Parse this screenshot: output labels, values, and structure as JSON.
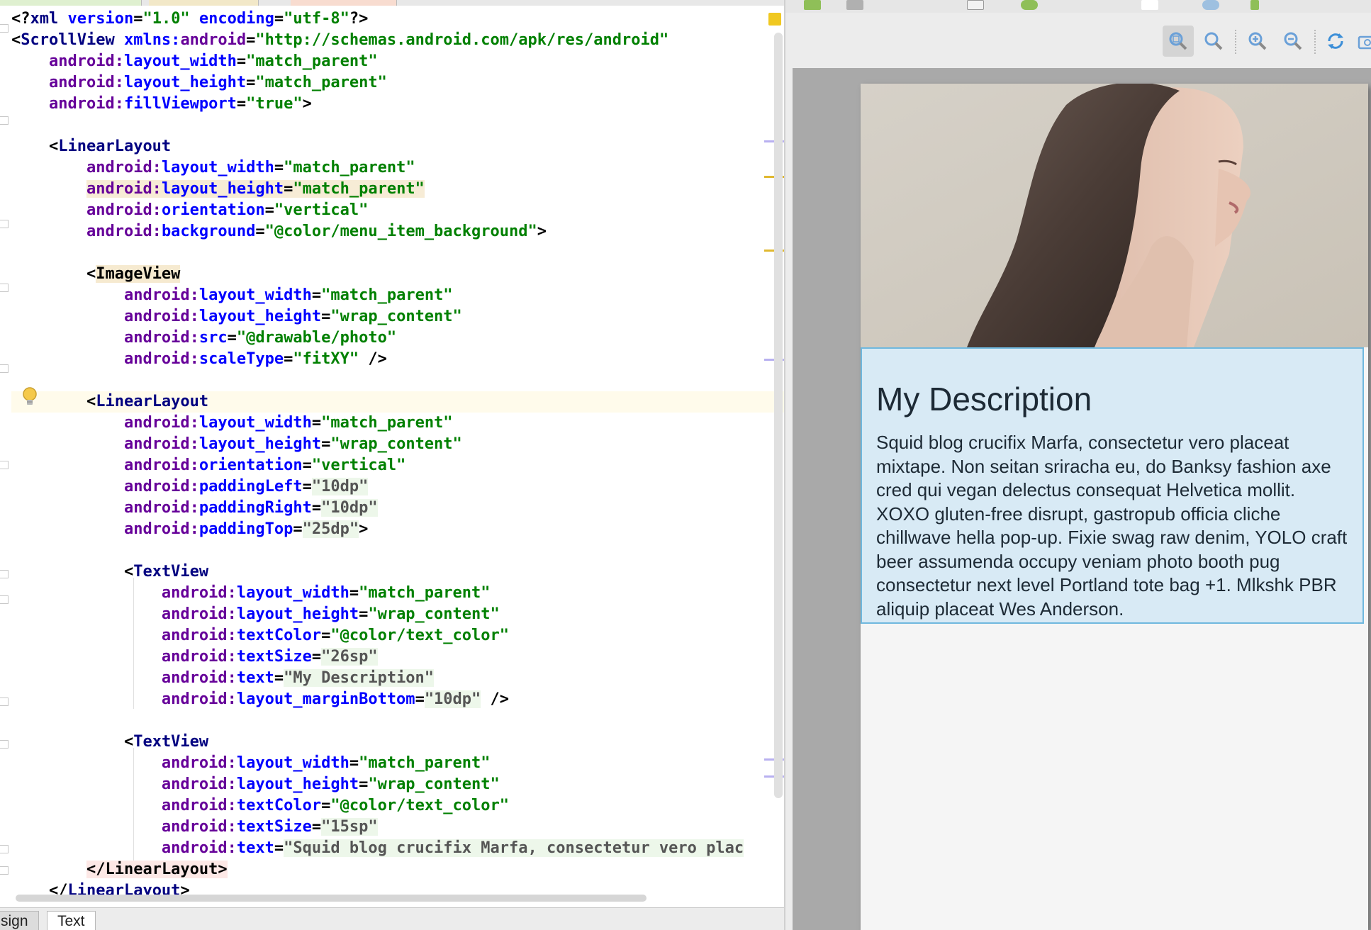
{
  "editor": {
    "lines": [
      {
        "indent": 0,
        "parts": [
          [
            "lt",
            "<?"
          ],
          [
            "tag",
            "xml "
          ],
          [
            "attr",
            "version"
          ],
          [
            "eq",
            "="
          ],
          [
            "val",
            "\"1.0\""
          ],
          [
            "attr",
            " encoding"
          ],
          [
            "eq",
            "="
          ],
          [
            "val",
            "\"utf-8\""
          ],
          [
            "lt",
            "?>"
          ]
        ]
      },
      {
        "indent": 0,
        "parts": [
          [
            "lt",
            "<"
          ],
          [
            "tag",
            "ScrollView "
          ],
          [
            "attr",
            "xmlns:"
          ],
          [
            "ns",
            "android"
          ],
          [
            "eq",
            "="
          ],
          [
            "val",
            "\"http://schemas.android.com/apk/res/android\""
          ]
        ]
      },
      {
        "indent": 4,
        "parts": [
          [
            "ns",
            "android:"
          ],
          [
            "attr",
            "layout_width"
          ],
          [
            "eq",
            "="
          ],
          [
            "val",
            "\"match_parent\""
          ]
        ]
      },
      {
        "indent": 4,
        "parts": [
          [
            "ns",
            "android:"
          ],
          [
            "attr",
            "layout_height"
          ],
          [
            "eq",
            "="
          ],
          [
            "val",
            "\"match_parent\""
          ]
        ]
      },
      {
        "indent": 4,
        "parts": [
          [
            "ns",
            "android:"
          ],
          [
            "attr",
            "fillViewport"
          ],
          [
            "eq",
            "="
          ],
          [
            "val",
            "\"true\""
          ],
          [
            "lt",
            ">"
          ]
        ]
      },
      {
        "indent": 0,
        "parts": []
      },
      {
        "indent": 4,
        "parts": [
          [
            "lt",
            "<"
          ],
          [
            "tag",
            "LinearLayout"
          ]
        ]
      },
      {
        "indent": 8,
        "parts": [
          [
            "ns",
            "android:"
          ],
          [
            "attr",
            "layout_width"
          ],
          [
            "eq",
            "="
          ],
          [
            "val",
            "\"match_parent\""
          ]
        ]
      },
      {
        "indent": 8,
        "hl": true,
        "parts": [
          [
            "ns",
            "android:"
          ],
          [
            "attr",
            "layout_height"
          ],
          [
            "eq",
            "="
          ],
          [
            "val",
            "\"match_parent\""
          ]
        ]
      },
      {
        "indent": 8,
        "parts": [
          [
            "ns",
            "android:"
          ],
          [
            "attr",
            "orientation"
          ],
          [
            "eq",
            "="
          ],
          [
            "val",
            "\"vertical\""
          ]
        ]
      },
      {
        "indent": 8,
        "parts": [
          [
            "ns",
            "android:"
          ],
          [
            "attr",
            "background"
          ],
          [
            "eq",
            "="
          ],
          [
            "val",
            "\"@color/menu_item_background\""
          ],
          [
            "lt",
            ">"
          ]
        ]
      },
      {
        "indent": 0,
        "parts": []
      },
      {
        "indent": 8,
        "parts": [
          [
            "lt",
            "<"
          ],
          [
            "tag-hl",
            "ImageView"
          ]
        ]
      },
      {
        "indent": 12,
        "parts": [
          [
            "ns",
            "android:"
          ],
          [
            "attr",
            "layout_width"
          ],
          [
            "eq",
            "="
          ],
          [
            "val",
            "\"match_parent\""
          ]
        ]
      },
      {
        "indent": 12,
        "parts": [
          [
            "ns",
            "android:"
          ],
          [
            "attr",
            "layout_height"
          ],
          [
            "eq",
            "="
          ],
          [
            "val",
            "\"wrap_content\""
          ]
        ]
      },
      {
        "indent": 12,
        "parts": [
          [
            "ns",
            "android:"
          ],
          [
            "attr",
            "src"
          ],
          [
            "eq",
            "="
          ],
          [
            "val",
            "\"@drawable/photo\""
          ]
        ]
      },
      {
        "indent": 12,
        "parts": [
          [
            "ns",
            "android:"
          ],
          [
            "attr",
            "scaleType"
          ],
          [
            "eq",
            "="
          ],
          [
            "val",
            "\"fitXY\""
          ],
          [
            "lt",
            " />"
          ]
        ]
      },
      {
        "indent": 0,
        "parts": []
      },
      {
        "indent": 8,
        "caret": true,
        "parts": [
          [
            "lt",
            "<"
          ],
          [
            "tag",
            "LinearLayout"
          ]
        ]
      },
      {
        "indent": 12,
        "parts": [
          [
            "ns",
            "android:"
          ],
          [
            "attr",
            "layout_width"
          ],
          [
            "eq",
            "="
          ],
          [
            "val",
            "\"match_parent\""
          ]
        ]
      },
      {
        "indent": 12,
        "parts": [
          [
            "ns",
            "android:"
          ],
          [
            "attr",
            "layout_height"
          ],
          [
            "eq",
            "="
          ],
          [
            "val",
            "\"wrap_content\""
          ]
        ]
      },
      {
        "indent": 12,
        "parts": [
          [
            "ns",
            "android:"
          ],
          [
            "attr",
            "orientation"
          ],
          [
            "eq",
            "="
          ],
          [
            "val",
            "\"vertical\""
          ]
        ]
      },
      {
        "indent": 12,
        "parts": [
          [
            "ns",
            "android:"
          ],
          [
            "attr",
            "paddingLeft"
          ],
          [
            "eq",
            "="
          ],
          [
            "strv",
            "\"10dp\""
          ]
        ]
      },
      {
        "indent": 12,
        "parts": [
          [
            "ns",
            "android:"
          ],
          [
            "attr",
            "paddingRight"
          ],
          [
            "eq",
            "="
          ],
          [
            "strv",
            "\"10dp\""
          ]
        ]
      },
      {
        "indent": 12,
        "parts": [
          [
            "ns",
            "android:"
          ],
          [
            "attr",
            "paddingTop"
          ],
          [
            "eq",
            "="
          ],
          [
            "strv",
            "\"25dp\""
          ],
          [
            "lt",
            ">"
          ]
        ]
      },
      {
        "indent": 0,
        "parts": []
      },
      {
        "indent": 12,
        "parts": [
          [
            "lt",
            "<"
          ],
          [
            "tag",
            "TextView"
          ]
        ]
      },
      {
        "indent": 16,
        "parts": [
          [
            "ns",
            "android:"
          ],
          [
            "attr",
            "layout_width"
          ],
          [
            "eq",
            "="
          ],
          [
            "val",
            "\"match_parent\""
          ]
        ]
      },
      {
        "indent": 16,
        "parts": [
          [
            "ns",
            "android:"
          ],
          [
            "attr",
            "layout_height"
          ],
          [
            "eq",
            "="
          ],
          [
            "val",
            "\"wrap_content\""
          ]
        ]
      },
      {
        "indent": 16,
        "parts": [
          [
            "ns",
            "android:"
          ],
          [
            "attr",
            "textColor"
          ],
          [
            "eq",
            "="
          ],
          [
            "val",
            "\"@color/text_color\""
          ]
        ]
      },
      {
        "indent": 16,
        "parts": [
          [
            "ns",
            "android:"
          ],
          [
            "attr",
            "textSize"
          ],
          [
            "eq",
            "="
          ],
          [
            "strv",
            "\"26sp\""
          ]
        ]
      },
      {
        "indent": 16,
        "parts": [
          [
            "ns",
            "android:"
          ],
          [
            "attr",
            "text"
          ],
          [
            "eq",
            "="
          ],
          [
            "strv",
            "\"My Description\""
          ]
        ]
      },
      {
        "indent": 16,
        "parts": [
          [
            "ns",
            "android:"
          ],
          [
            "attr",
            "layout_marginBottom"
          ],
          [
            "eq",
            "="
          ],
          [
            "strv",
            "\"10dp\""
          ],
          [
            "lt",
            " />"
          ]
        ]
      },
      {
        "indent": 0,
        "parts": []
      },
      {
        "indent": 12,
        "parts": [
          [
            "lt",
            "<"
          ],
          [
            "tag",
            "TextView"
          ]
        ]
      },
      {
        "indent": 16,
        "parts": [
          [
            "ns",
            "android:"
          ],
          [
            "attr",
            "layout_width"
          ],
          [
            "eq",
            "="
          ],
          [
            "val",
            "\"match_parent\""
          ]
        ]
      },
      {
        "indent": 16,
        "parts": [
          [
            "ns",
            "android:"
          ],
          [
            "attr",
            "layout_height"
          ],
          [
            "eq",
            "="
          ],
          [
            "val",
            "\"wrap_content\""
          ]
        ]
      },
      {
        "indent": 16,
        "parts": [
          [
            "ns",
            "android:"
          ],
          [
            "attr",
            "textColor"
          ],
          [
            "eq",
            "="
          ],
          [
            "val",
            "\"@color/text_color\""
          ]
        ]
      },
      {
        "indent": 16,
        "parts": [
          [
            "ns",
            "android:"
          ],
          [
            "attr",
            "textSize"
          ],
          [
            "eq",
            "="
          ],
          [
            "strv",
            "\"15sp\""
          ]
        ]
      },
      {
        "indent": 16,
        "parts": [
          [
            "ns",
            "android:"
          ],
          [
            "attr",
            "text"
          ],
          [
            "eq",
            "="
          ],
          [
            "strv",
            "\"Squid blog crucifix Marfa, consectetur vero plac"
          ]
        ]
      },
      {
        "indent": 8,
        "parts": [
          [
            "end-hl",
            "</"
          ],
          [
            "end-hl",
            "LinearLayout"
          ],
          [
            "end-hl",
            ">"
          ]
        ]
      },
      {
        "indent": 4,
        "parts": [
          [
            "lt",
            "</"
          ],
          [
            "tag",
            "LinearLayout"
          ],
          [
            "lt",
            ">"
          ]
        ]
      }
    ]
  },
  "bottom_tabs": {
    "design_label": "sign",
    "text_label": "Text"
  },
  "preview": {
    "title": "My Description",
    "body": "Squid blog crucifix Marfa, consectetur vero placeat mixtape. Non seitan sriracha eu, do Banksy fashion axe cred qui vegan delectus consequat Helvetica mollit. XOXO gluten-free disrupt, gastropub officia cliche chillwave hella pop-up. Fixie swag raw denim, YOLO craft beer assumenda occupy veniam photo booth pug consectetur next level Portland tote bag +1. Mlkshk PBR aliquip placeat Wes Anderson."
  },
  "zoom_toolbar": {
    "icons": [
      "zoom-to-fit-icon",
      "actual-size-icon",
      "zoom-in-icon",
      "zoom-out-icon",
      "refresh-icon",
      "screenshot-icon"
    ]
  },
  "colors": {
    "text_block_bg": "#d8eaf5",
    "text_block_border": "#6fb8de",
    "canvas_bg": "#a9a9a9"
  }
}
